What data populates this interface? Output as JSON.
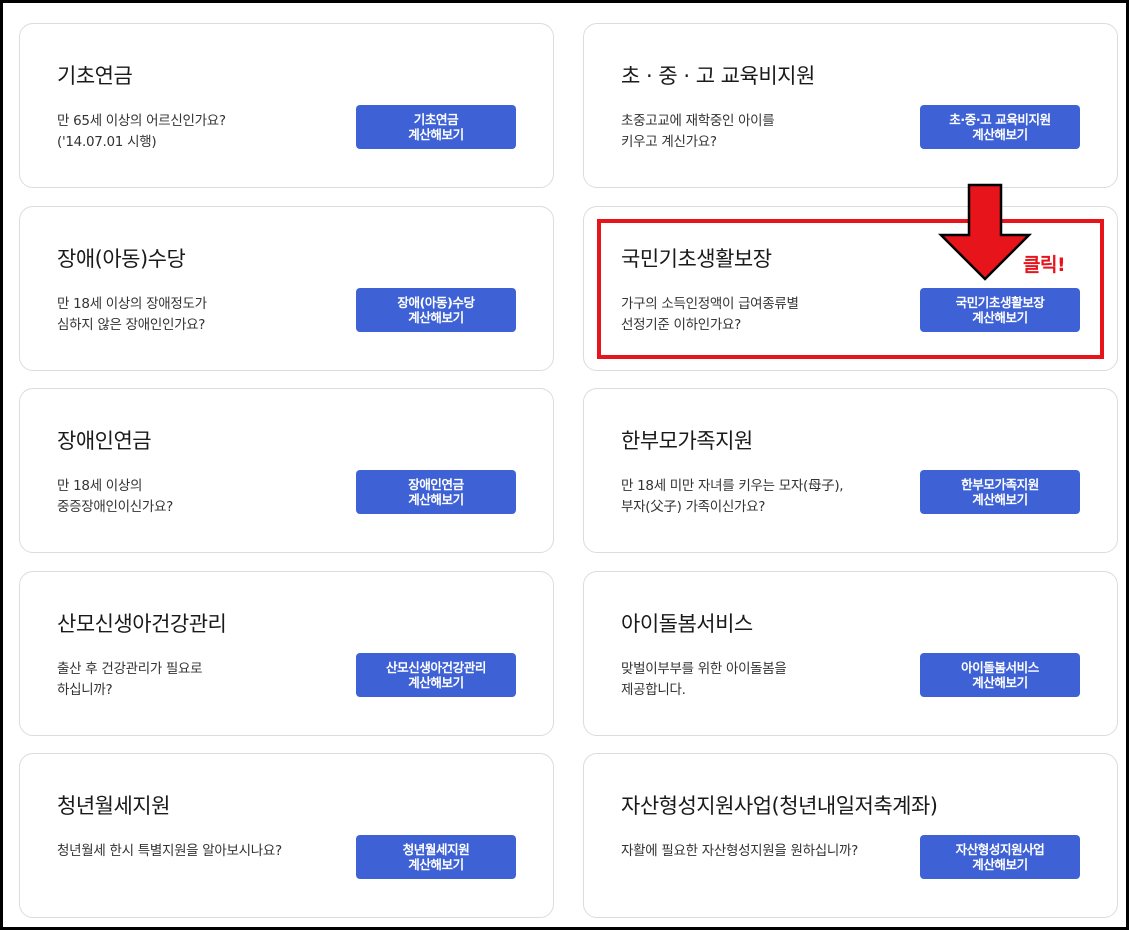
{
  "cards": [
    {
      "title": "기초연금",
      "desc": [
        "만 65세 이상의 어르신인가요?",
        "('14.07.01 시행)"
      ],
      "button": [
        "기초연금",
        "계산해보기"
      ]
    },
    {
      "title": "초 · 중 · 고 교육비지원",
      "desc": [
        "초중고교에 재학중인 아이를",
        "키우고 계신가요?"
      ],
      "button": [
        "초·중·고 교육비지원",
        "계산해보기"
      ]
    },
    {
      "title": "장애(아동)수당",
      "desc": [
        "만 18세 이상의 장애정도가",
        "심하지 않은 장애인인가요?"
      ],
      "button": [
        "장애(아동)수당",
        "계산해보기"
      ]
    },
    {
      "title": "국민기초생활보장",
      "desc": [
        "가구의 소득인정액이 급여종류별",
        "선정기준 이하인가요?"
      ],
      "button": [
        "국민기초생활보장",
        "계산해보기"
      ]
    },
    {
      "title": "장애인연금",
      "desc": [
        "만 18세 이상의",
        "중증장애인이신가요?"
      ],
      "button": [
        "장애인연금",
        "계산해보기"
      ]
    },
    {
      "title": "한부모가족지원",
      "desc": [
        "만 18세 미만 자녀를 키우는 모자(母子),",
        "부자(父子) 가족이신가요?"
      ],
      "button": [
        "한부모가족지원",
        "계산해보기"
      ]
    },
    {
      "title": "산모신생아건강관리",
      "desc": [
        "출산 후 건강관리가 필요로",
        "하십니까?"
      ],
      "button": [
        "산모신생아건강관리",
        "계산해보기"
      ]
    },
    {
      "title": "아이돌봄서비스",
      "desc": [
        "맞벌이부부를 위한 아이돌봄을",
        "제공합니다."
      ],
      "button": [
        "아이돌봄서비스",
        "계산해보기"
      ]
    },
    {
      "title": "청년월세지원",
      "desc": [
        "청년월세 한시 특별지원을 알아보시나요?"
      ],
      "button": [
        "청년월세지원",
        "계산해보기"
      ]
    },
    {
      "title": "자산형성지원사업(청년내일저축계좌)",
      "desc": [
        "자활에 필요한 자산형성지원을 원하십니까?"
      ],
      "button": [
        "자산형성지원사업",
        "계산해보기"
      ]
    }
  ],
  "annotation": {
    "label": "클릭!",
    "color": "#e8141c"
  },
  "colors": {
    "button": "#3e62d6",
    "border": "#dcdcdc"
  }
}
